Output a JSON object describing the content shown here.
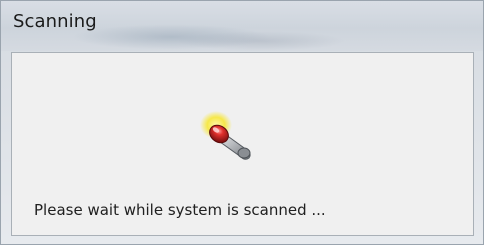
{
  "window": {
    "title": "Scanning"
  },
  "content": {
    "icon": "scanning-wand-icon",
    "status_text": "Please wait while system is scanned ..."
  }
}
